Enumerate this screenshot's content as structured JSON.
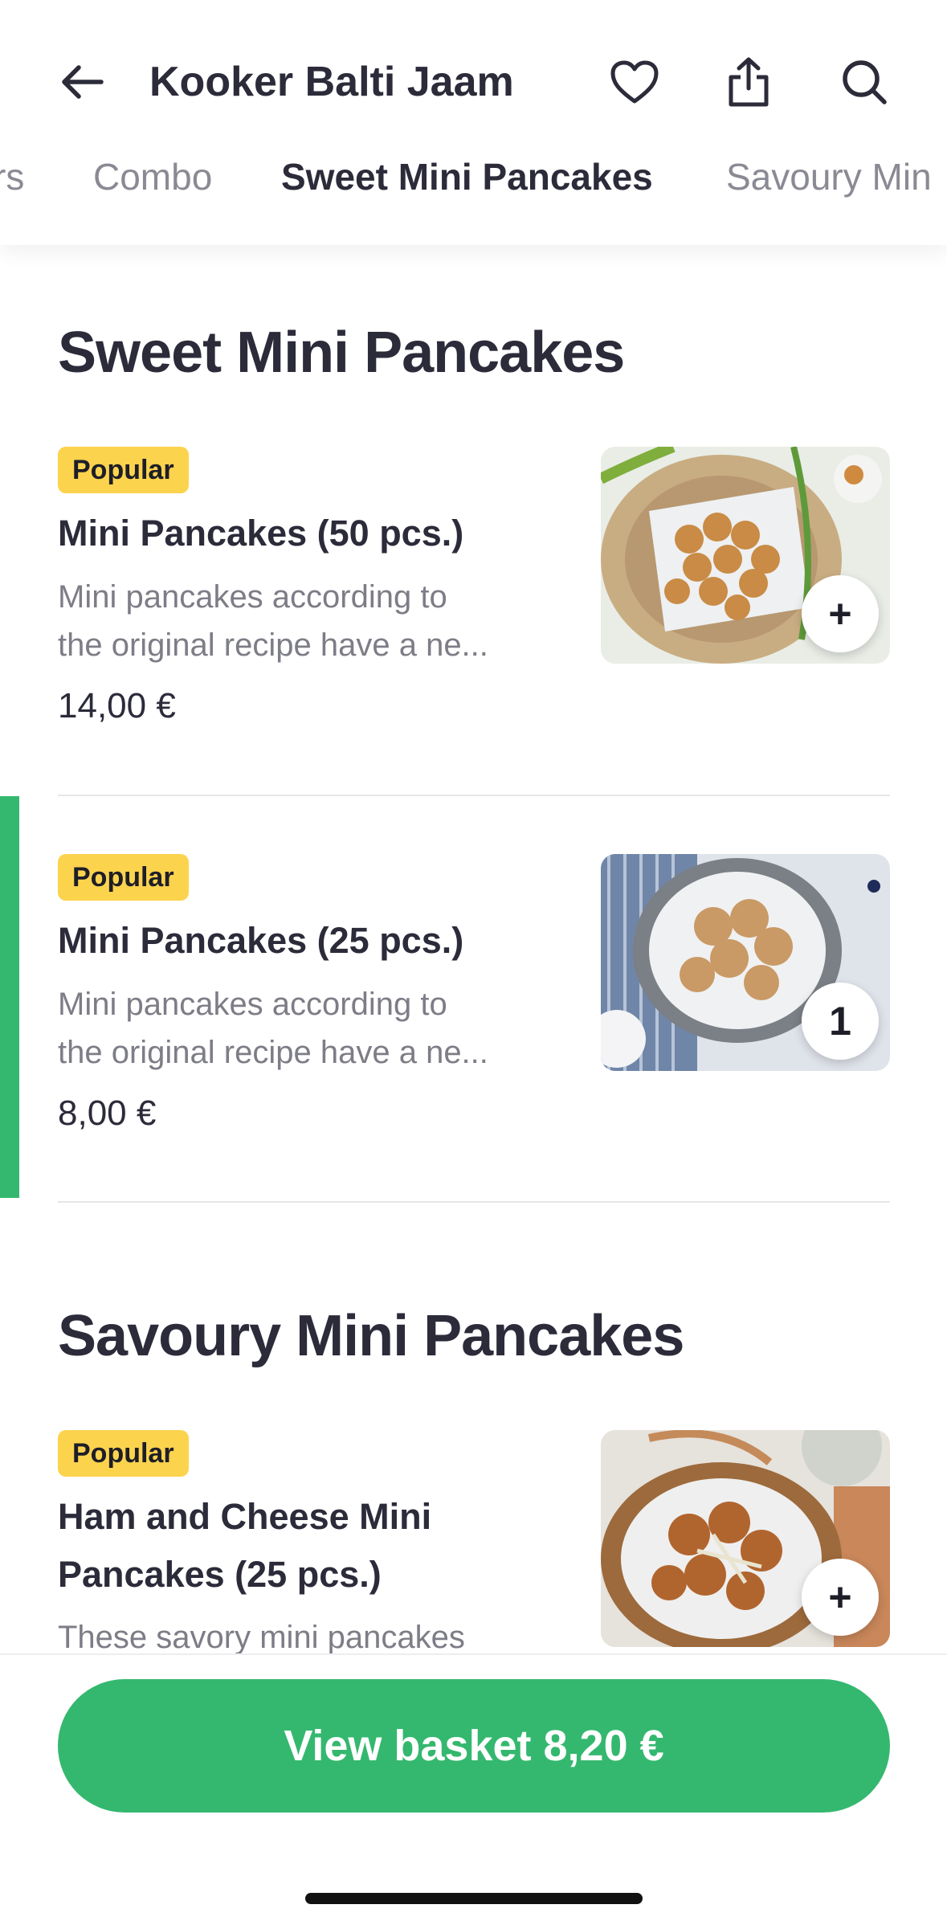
{
  "header": {
    "title": "Kooker Balti Jaam",
    "icons": [
      "back-arrow-icon",
      "heart-icon",
      "share-icon",
      "search-icon"
    ]
  },
  "tabs": [
    "rs",
    "Combo",
    "Sweet Mini Pancakes",
    "Savoury Min"
  ],
  "active_tab": "Sweet Mini Pancakes",
  "sections": [
    {
      "title": "Sweet Mini Pancakes",
      "items": [
        {
          "badge": "Popular",
          "name": "Mini Pancakes (50 pcs.)",
          "desc_line1": "Mini pancakes according to",
          "desc_line2": "the original recipe have a ne...",
          "price": "14,00 €",
          "action": "+"
        },
        {
          "badge": "Popular",
          "name": "Mini Pancakes (25 pcs.)",
          "desc_line1": "Mini pancakes according to",
          "desc_line2": "the original recipe have a ne...",
          "price": "8,00 €",
          "action": "1"
        }
      ]
    },
    {
      "title": "Savoury Mini Pancakes",
      "items": [
        {
          "badge": "Popular",
          "name_line1": "Ham and Cheese Mini",
          "name_line2": "Pancakes (25 pcs.)",
          "desc_line1": "These savory mini pancakes",
          "action": "+"
        }
      ]
    }
  ],
  "basket": {
    "label": "View basket 8,20 €"
  },
  "colors": {
    "accent": "#34b86f",
    "badge": "#fcd34d",
    "text": "#2b2b3a",
    "muted": "#7d7d87"
  }
}
